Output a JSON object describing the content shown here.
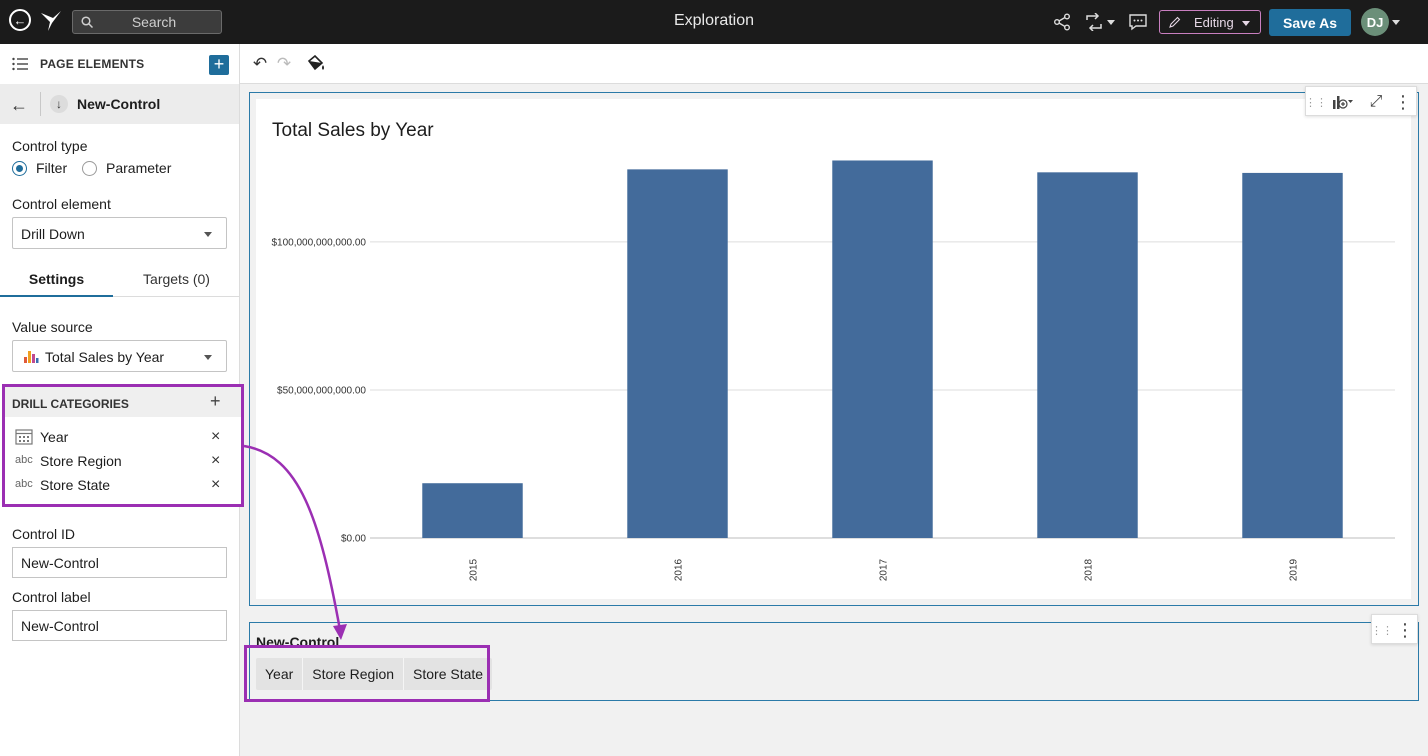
{
  "topbar": {
    "search_placeholder": "Search",
    "title": "Exploration",
    "editing_label": "Editing",
    "save_as_label": "Save As",
    "avatar_initials": "DJ"
  },
  "left_panel": {
    "page_elements_label": "PAGE ELEMENTS",
    "control_name": "New-Control",
    "control_type_label": "Control type",
    "control_type_options": [
      "Filter",
      "Parameter"
    ],
    "control_type_selected": "Filter",
    "control_element_label": "Control element",
    "control_element_value": "Drill Down",
    "tabs": [
      "Settings",
      "Targets (0)"
    ],
    "active_tab": "Settings",
    "value_source_label": "Value source",
    "value_source_value": "Total Sales by Year",
    "drill_categories_label": "DRILL CATEGORIES",
    "drill_categories": [
      {
        "icon": "calendar-icon",
        "type_label": "",
        "name": "Year"
      },
      {
        "icon": "text-type-icon",
        "type_label": "abc",
        "name": "Store Region"
      },
      {
        "icon": "text-type-icon",
        "type_label": "abc",
        "name": "Store State"
      }
    ],
    "control_id_label": "Control ID",
    "control_id_value": "New-Control",
    "control_label_label": "Control label",
    "control_label_value": "New-Control"
  },
  "chart_data": {
    "type": "bar",
    "title": "Total Sales by Year",
    "categories": [
      "2015",
      "2016",
      "2017",
      "2018",
      "2019"
    ],
    "values": [
      18500000000,
      124500000000,
      127500000000,
      123500000000,
      123300000000
    ],
    "ytick_labels": [
      "$0.00",
      "$50,000,000,000.00",
      "$100,000,000,000.00"
    ],
    "ytick_values": [
      0,
      50000000000,
      100000000000
    ],
    "ylim": [
      0,
      128000000000
    ],
    "xlabel": "",
    "ylabel": "",
    "grid": true,
    "bar_color": "#436b9b"
  },
  "control_card": {
    "title": "New-Control",
    "segments": [
      "Year",
      "Store Region",
      "Store State"
    ]
  },
  "colors": {
    "accent": "#1f6d9b",
    "highlight": "#9b2fb3",
    "topbar": "#1b1b1b"
  }
}
